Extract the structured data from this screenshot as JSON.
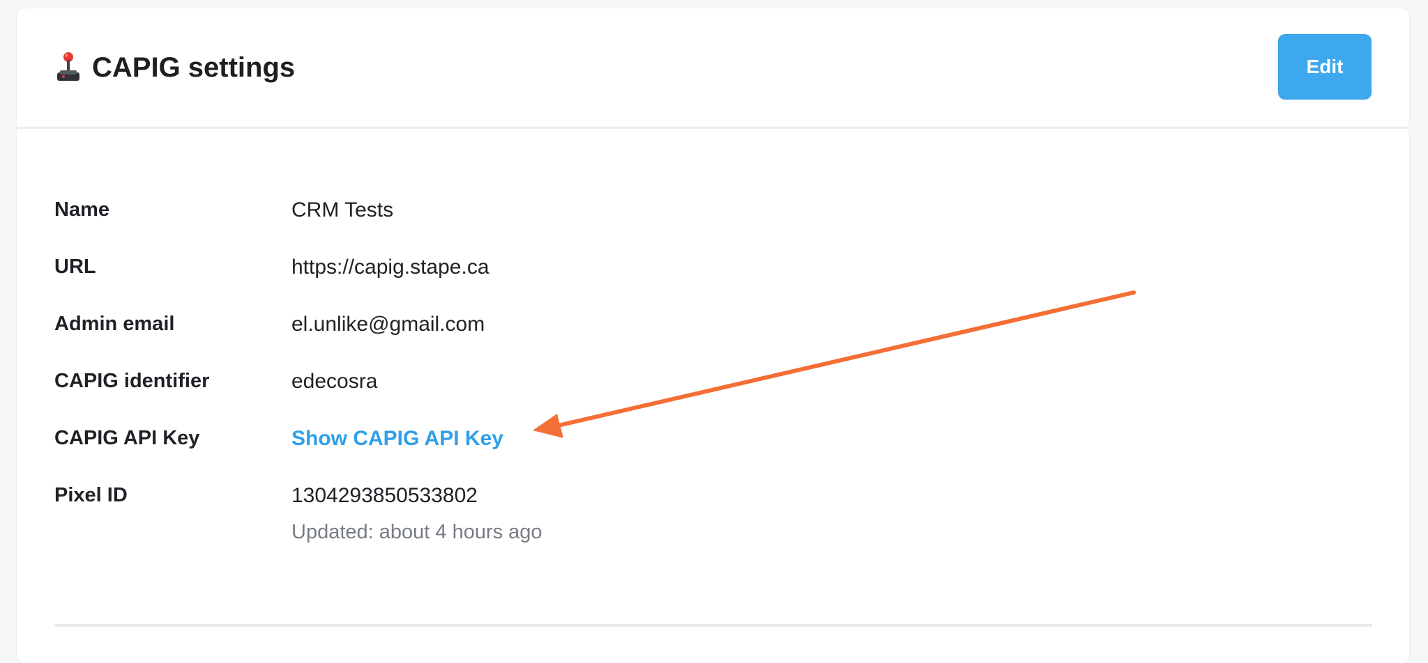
{
  "page": {
    "title": "CAPIG settings",
    "title_icon": "joystick-icon",
    "edit_label": "Edit"
  },
  "details": [
    {
      "label": "Name",
      "value": "CRM Tests"
    },
    {
      "label": "URL",
      "value": "https://capig.stape.ca"
    },
    {
      "label": "Admin email",
      "value": "el.unlike@gmail.com"
    },
    {
      "label": "CAPIG identifier",
      "value": "edecosra"
    },
    {
      "label": "CAPIG API Key",
      "value": "Show CAPIG API Key",
      "link": true
    },
    {
      "label": "Pixel ID",
      "value": "1304293850533802",
      "note": "Updated: about 4 hours ago"
    }
  ],
  "colors": {
    "accent": "#3ea8ef",
    "link": "#2f9fe8",
    "annotation_arrow": "#f46f35"
  }
}
